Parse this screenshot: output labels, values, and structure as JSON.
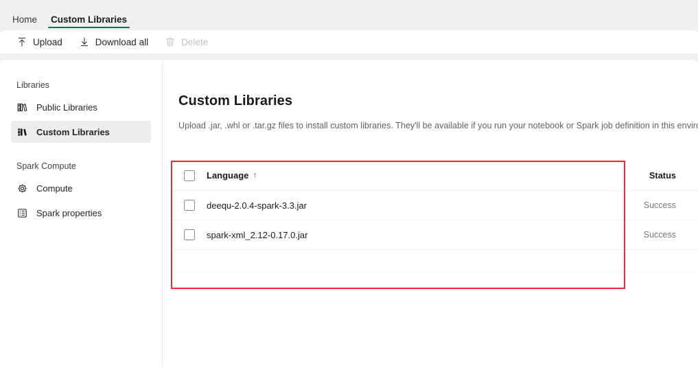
{
  "colors": {
    "accent": "#0f6f5c",
    "annotation": "#ee2b34",
    "selected_nav_bg": "#ededed",
    "status_text": "#777777"
  },
  "tabs": [
    {
      "label": "Home",
      "active": false
    },
    {
      "label": "Custom Libraries",
      "active": true
    }
  ],
  "toolbar": {
    "upload_label": "Upload",
    "upload_icon": "arrow-up-bar-icon",
    "download_all_label": "Download all",
    "download_all_icon": "arrow-down-bar-icon",
    "delete_label": "Delete",
    "delete_icon": "trash-icon",
    "delete_disabled": true
  },
  "sidebar": {
    "sections": [
      {
        "title": "Libraries",
        "items": [
          {
            "label": "Public Libraries",
            "icon": "public-library-books-icon",
            "selected": false
          },
          {
            "label": "Custom Libraries",
            "icon": "custom-library-books-icon",
            "selected": true
          }
        ]
      },
      {
        "title": "Spark Compute",
        "items": [
          {
            "label": "Compute",
            "icon": "chip-gear-icon",
            "selected": false
          },
          {
            "label": "Spark properties",
            "icon": "list-properties-icon",
            "selected": false
          }
        ]
      }
    ]
  },
  "main": {
    "title": "Custom Libraries",
    "description": "Upload .jar, .whl or .tar.gz files to install custom libraries. They'll be available if you run your notebook or Spark job definition in this environment"
  },
  "table": {
    "columns": {
      "language": "Language",
      "sort_indicator": "↑",
      "status": "Status"
    },
    "rows": [
      {
        "name": "deequ-2.0.4-spark-3.3.jar",
        "status": "Success",
        "checked": false
      },
      {
        "name": "spark-xml_2.12-0.17.0.jar",
        "status": "Success",
        "checked": false
      }
    ]
  }
}
